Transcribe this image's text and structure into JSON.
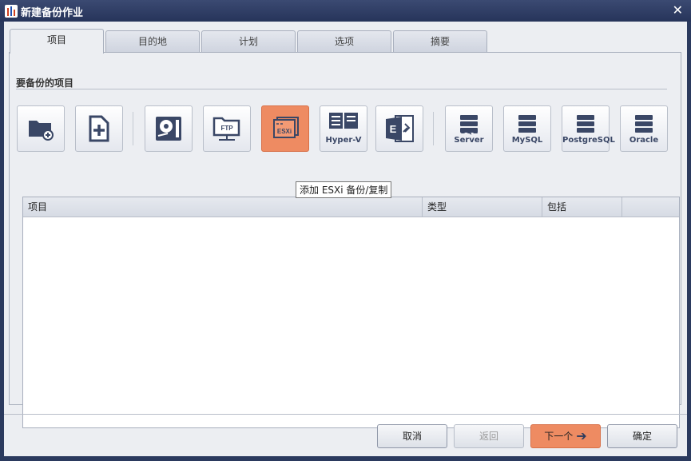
{
  "window": {
    "title": "新建备份作业",
    "close_glyph": "✕"
  },
  "tabs": [
    {
      "label": "项目",
      "active": true
    },
    {
      "label": "目的地",
      "active": false
    },
    {
      "label": "计划",
      "active": false
    },
    {
      "label": "选项",
      "active": false
    },
    {
      "label": "摘要",
      "active": false
    }
  ],
  "section": {
    "title": "要备份的项目"
  },
  "toolbar": {
    "buttons": [
      {
        "icon": "folder-add-icon",
        "label": ""
      },
      {
        "icon": "file-add-icon",
        "label": ""
      },
      {
        "icon": "disk-icon",
        "label": ""
      },
      {
        "icon": "ftp-folder-icon",
        "label": "FTP"
      },
      {
        "icon": "esxi-icon",
        "label": "ESXi",
        "active": true
      },
      {
        "icon": "hyper-v-icon",
        "label": "Hyper-V"
      },
      {
        "icon": "exchange-icon",
        "label": "E"
      },
      {
        "icon": "database-icon",
        "label": "SQL Server"
      },
      {
        "icon": "database-icon",
        "label": "MySQL"
      },
      {
        "icon": "database-icon",
        "label": "PostgreSQL"
      },
      {
        "icon": "database-icon",
        "label": "Oracle"
      }
    ],
    "tooltip": "添加 ESXi 备份/复制"
  },
  "table": {
    "columns": [
      "项目",
      "类型",
      "包括",
      ""
    ],
    "rows": []
  },
  "footer": {
    "cancel": "取消",
    "back": "返回",
    "next": "下一个",
    "ok": "确定"
  },
  "colors": {
    "accent": "#ee8b62",
    "frame": "#2b3a5e",
    "icon": "#3a4766"
  }
}
